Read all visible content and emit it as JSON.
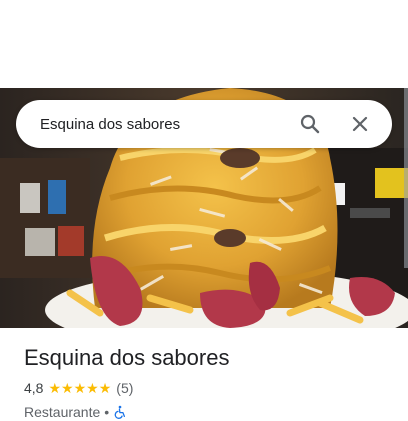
{
  "search": {
    "query": "Esquina dos sabores",
    "search_icon": "search-icon",
    "close_icon": "close-icon"
  },
  "photo": {
    "subject": "food-photo",
    "icon": "hero-photo"
  },
  "place": {
    "name": "Esquina dos sabores",
    "rating": "4,8",
    "stars": 5,
    "review_count": "(5)",
    "category": "Restaurante",
    "separator": "•",
    "accessibility_icon": "wheelchair-icon"
  },
  "colors": {
    "star": "#fbbc04",
    "accessibility": "#1a73e8",
    "text_primary": "#202124",
    "text_secondary": "#5f6368"
  }
}
